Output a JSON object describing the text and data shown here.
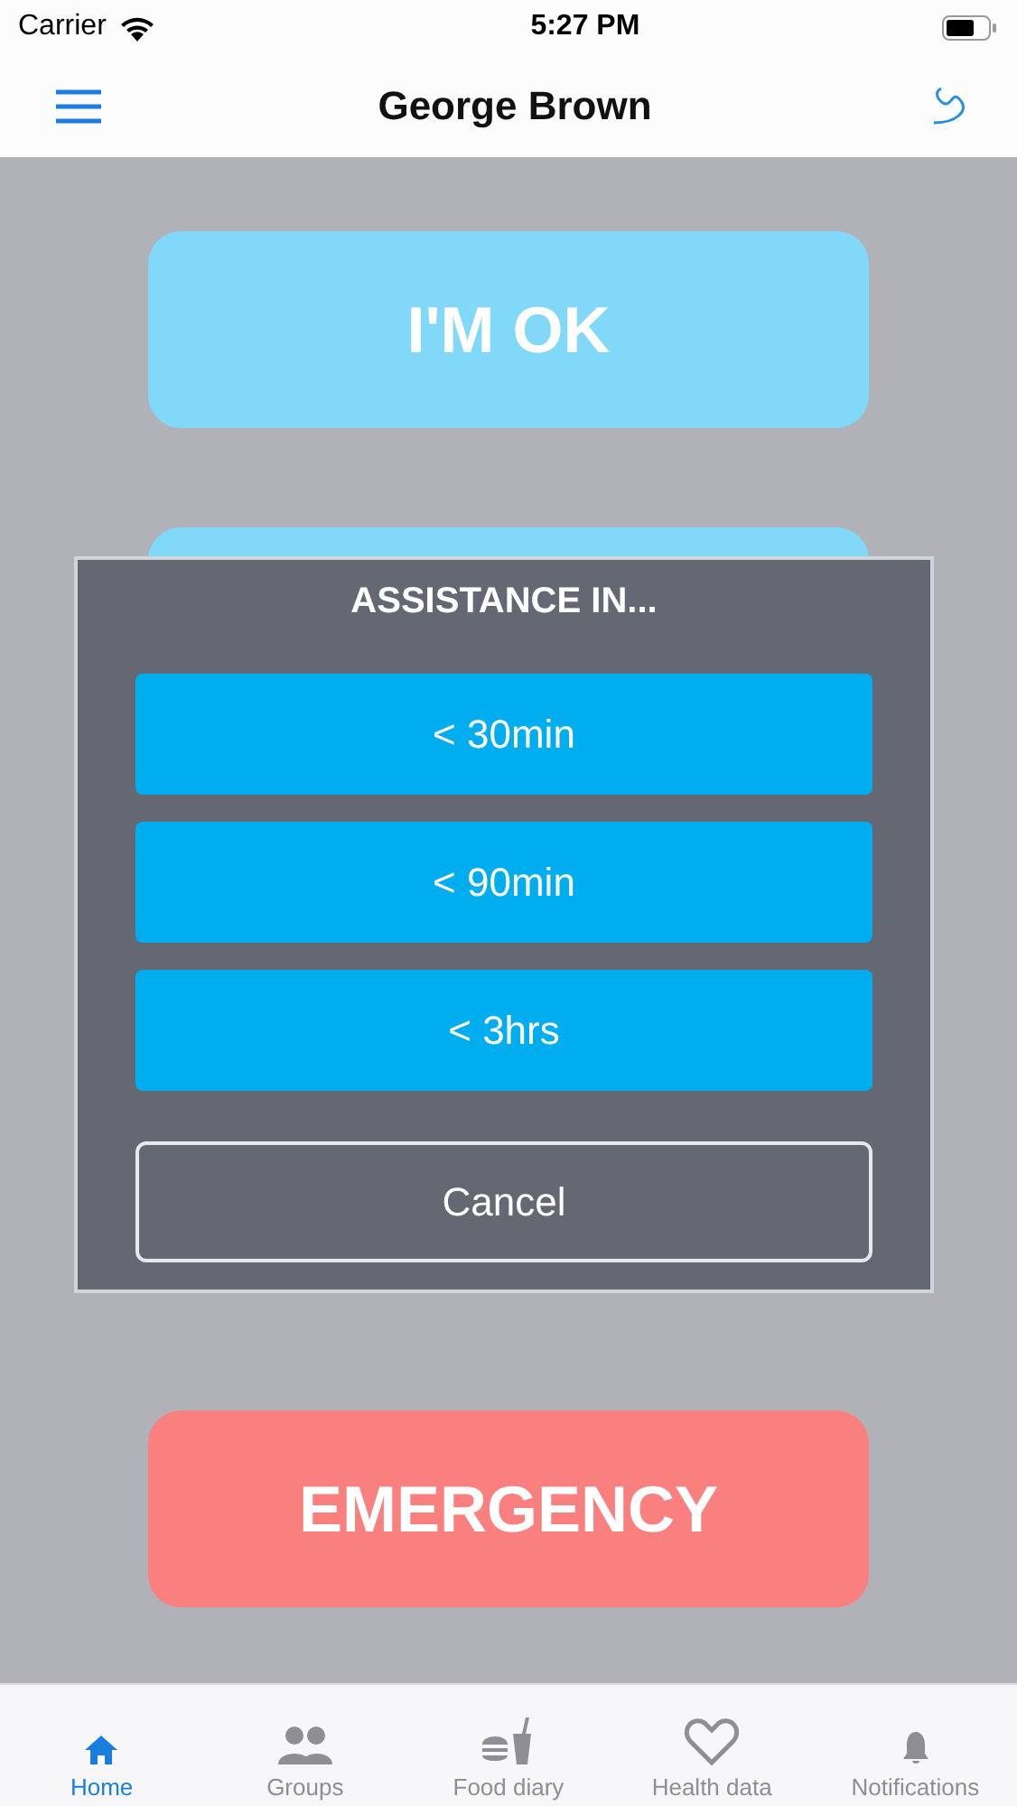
{
  "status_bar": {
    "carrier": "Carrier",
    "time": "5:27 PM"
  },
  "header": {
    "title": "George Brown"
  },
  "actions": [
    {
      "kind": "ok",
      "label": "I'M OK"
    },
    {
      "kind": "hidden"
    },
    {
      "kind": "emergency",
      "label": "EMERGENCY"
    }
  ],
  "dialog": {
    "title": "ASSISTANCE IN...",
    "options": [
      "< 30min",
      "< 90min",
      "< 3hrs"
    ],
    "cancel": "Cancel"
  },
  "tabs": [
    {
      "label": "Home",
      "kind": "home",
      "selected": true
    },
    {
      "label": "Groups",
      "kind": "groups",
      "selected": false
    },
    {
      "label": "Food diary",
      "kind": "food",
      "selected": false
    },
    {
      "label": "Health data",
      "kind": "heart",
      "selected": false
    },
    {
      "label": "Notifications",
      "kind": "bell",
      "selected": false
    }
  ]
}
